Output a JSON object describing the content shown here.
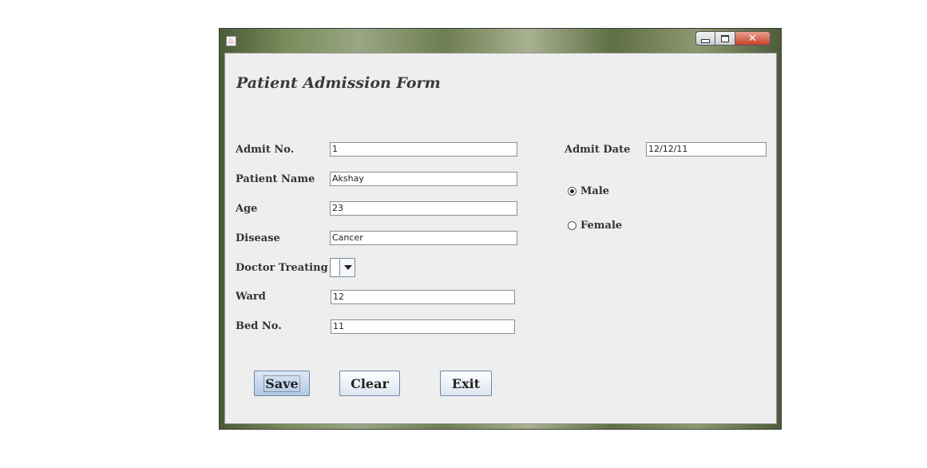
{
  "window": {
    "icon": "java-cup-icon",
    "controls": {
      "minimize": "minimize-icon",
      "maximize": "maximize-icon",
      "close_label": "✕"
    }
  },
  "form": {
    "title": "Patient Admission Form",
    "fields": {
      "admit_no": {
        "label": "Admit No.",
        "value": "1"
      },
      "patient_name": {
        "label": "Patient Name",
        "value": "Akshay"
      },
      "age": {
        "label": "Age",
        "value": "23"
      },
      "disease": {
        "label": "Disease",
        "value": "Cancer"
      },
      "doctor_treating": {
        "label": "Doctor Treating",
        "value": ""
      },
      "ward": {
        "label": "Ward",
        "value": "12"
      },
      "bed_no": {
        "label": "Bed No.",
        "value": "11"
      },
      "admit_date": {
        "label": "Admit Date",
        "value": "12/12/11"
      }
    },
    "gender": {
      "options": [
        {
          "label": "Male",
          "selected": true
        },
        {
          "label": "Female",
          "selected": false
        }
      ]
    },
    "buttons": {
      "save": "Save",
      "clear": "Clear",
      "exit": "Exit"
    }
  }
}
